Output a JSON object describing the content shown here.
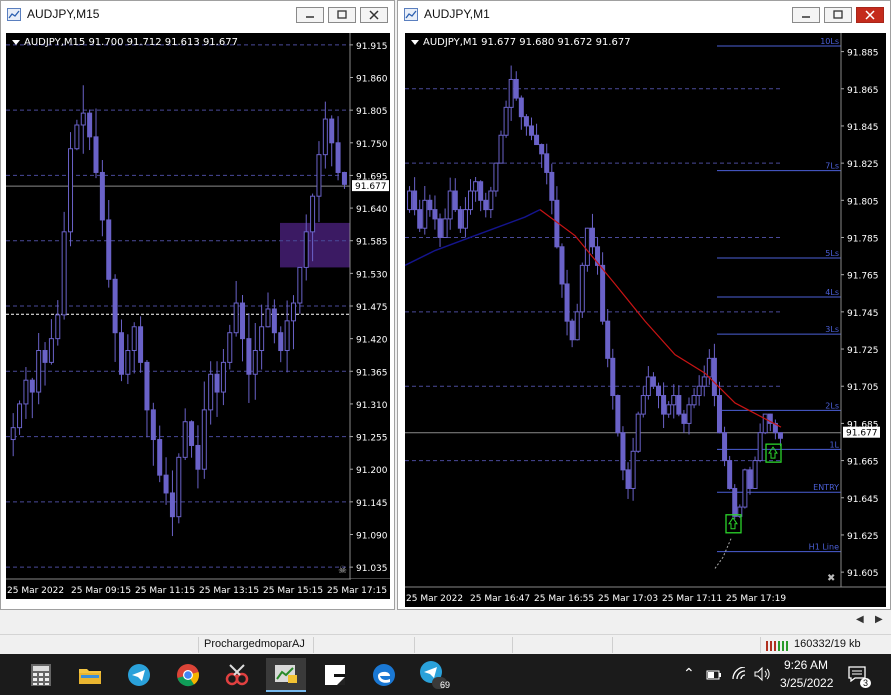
{
  "left_window": {
    "title": "AUDJPY,M15",
    "ohlc_label": "AUDJPY,M15  91.700 91.712 91.613 91.677",
    "price_scale": [
      "91.915",
      "91.860",
      "91.805",
      "91.750",
      "91.695",
      "91.640",
      "91.585",
      "91.530",
      "91.475",
      "91.420",
      "91.365",
      "91.310",
      "91.255",
      "91.200",
      "91.145",
      "91.090",
      "91.035"
    ],
    "current_price": "91.677",
    "time_labels": [
      "25 Mar 2022",
      "25 Mar 09:15",
      "25 Mar 11:15",
      "25 Mar 13:15",
      "25 Mar 15:15",
      "25 Mar 17:15"
    ]
  },
  "right_window": {
    "title": "AUDJPY,M1",
    "ohlc_label": "AUDJPY,M1  91.677 91.680 91.672 91.677",
    "price_scale": [
      "91.885",
      "91.865",
      "91.845",
      "91.825",
      "91.805",
      "91.785",
      "91.765",
      "91.745",
      "91.725",
      "91.705",
      "91.685",
      "91.665",
      "91.645",
      "91.625",
      "91.605"
    ],
    "current_price": "91.677",
    "time_labels": [
      "25 Mar 2022",
      "25 Mar 16:47",
      "25 Mar 16:55",
      "25 Mar 17:03",
      "25 Mar 17:11",
      "25 Mar 17:19"
    ],
    "level_labels": [
      "10Ls",
      "7Ls",
      "5Ls",
      "4Ls",
      "3Ls",
      "2Ls",
      "1L",
      "ENTRY",
      "H1 Line"
    ]
  },
  "statusbar": {
    "profile": "ProchargedmoparAJ",
    "traffic": "160332/19 kb"
  },
  "taskbar": {
    "apps": [
      "calculator-icon",
      "file-explorer-icon",
      "telegram-icon",
      "chrome-icon",
      "snipping-tool-icon",
      "metatrader-icon",
      "sticky-notes-icon",
      "edge-icon",
      "telegram-badge-icon"
    ],
    "telegram_badge": "69",
    "time": "9:26 AM",
    "date": "3/25/2022",
    "notifications": "3"
  },
  "colors": {
    "candle": "#6a62c8",
    "grid": "#4a4a9a",
    "level_line": "#4b5fd6",
    "ma_blue": "#14148c",
    "ma_red": "#c81414",
    "zone": "#3b1a63",
    "arrow_green": "#2bd42b"
  }
}
